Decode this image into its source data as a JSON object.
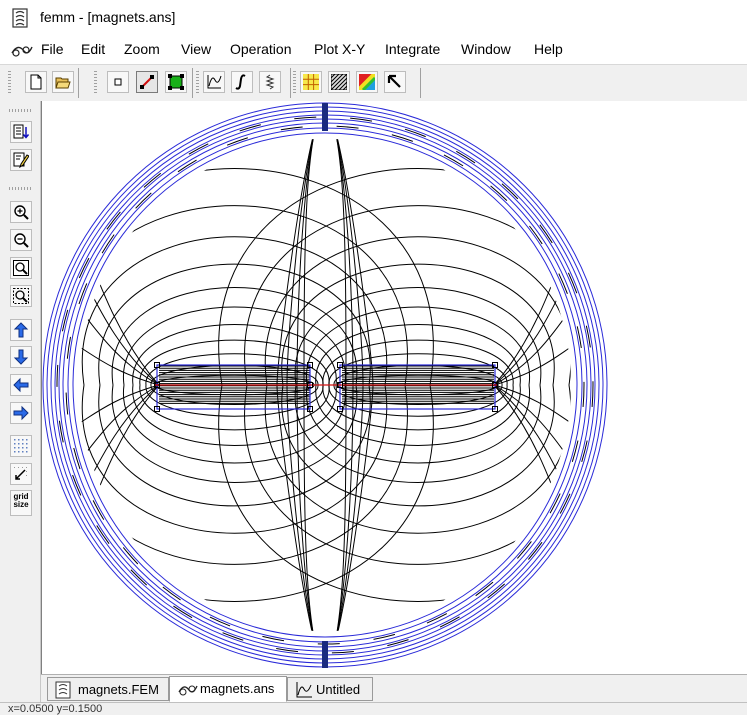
{
  "window": {
    "title": "femm - [magnets.ans]",
    "icon": "femm-app-icon"
  },
  "menu": {
    "items": [
      {
        "label": "File"
      },
      {
        "label": "Edit"
      },
      {
        "label": "Zoom"
      },
      {
        "label": "View"
      },
      {
        "label": "Operation"
      },
      {
        "label": "Plot X-Y"
      },
      {
        "label": "Integrate"
      },
      {
        "label": "Window"
      },
      {
        "label": "Help"
      }
    ]
  },
  "toolbar": {
    "buttons": [
      {
        "name": "new-file-icon"
      },
      {
        "name": "open-folder-icon"
      },
      {
        "name": "point-mode-icon"
      },
      {
        "name": "line-mode-icon"
      },
      {
        "name": "block-mode-icon"
      },
      {
        "name": "plot-xy-icon"
      },
      {
        "name": "integrate-icon"
      },
      {
        "name": "spring-icon"
      },
      {
        "name": "grid-display-icon"
      },
      {
        "name": "hatch-icon"
      },
      {
        "name": "density-plot-icon"
      },
      {
        "name": "pointer-icon"
      }
    ]
  },
  "left_toolbar": {
    "grid_size_label": "grid size",
    "buttons": [
      {
        "name": "show-results-icon"
      },
      {
        "name": "edit-notes-icon"
      },
      {
        "name": "zoom-in-icon"
      },
      {
        "name": "zoom-out-icon"
      },
      {
        "name": "zoom-natural-icon"
      },
      {
        "name": "zoom-window-icon"
      },
      {
        "name": "pan-up-icon"
      },
      {
        "name": "pan-down-icon"
      },
      {
        "name": "pan-left-icon"
      },
      {
        "name": "pan-right-icon"
      },
      {
        "name": "show-grid-icon"
      },
      {
        "name": "snap-grid-icon"
      },
      {
        "name": "grid-size-icon"
      }
    ]
  },
  "tabs": [
    {
      "label": "magnets.FEM",
      "icon": "fem-file-icon",
      "active": false
    },
    {
      "label": "magnets.ans",
      "icon": "femm-ans-icon",
      "active": true
    },
    {
      "label": "Untitled",
      "icon": "plot-icon",
      "active": false
    }
  ],
  "status": {
    "text": "x=0.0500 y=0.1500"
  },
  "colors": {
    "boundary": "#2a2ad8",
    "flux_lines": "#000000",
    "magnet_line": "#d01010"
  }
}
